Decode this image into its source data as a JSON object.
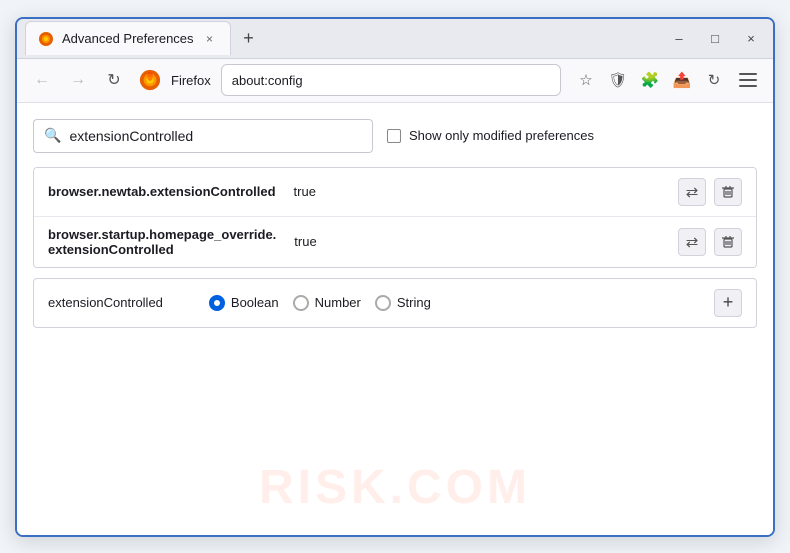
{
  "window": {
    "title": "Advanced Preferences",
    "tab_close": "×",
    "new_tab": "+",
    "minimize": "–",
    "maximize": "□",
    "close": "×"
  },
  "navbar": {
    "back": "←",
    "forward": "→",
    "refresh": "↻",
    "brand": "Firefox",
    "address": "about:config",
    "star_icon": "☆",
    "shield_icon": "🛡",
    "extension_icon": "🧩",
    "share_icon": "📤",
    "sync_icon": "↻"
  },
  "content": {
    "search_value": "extensionControlled",
    "search_placeholder": "extensionControlled",
    "checkbox_label": "Show only modified preferences",
    "watermark": "RISK.COM"
  },
  "results": [
    {
      "name": "browser.newtab.extensionControlled",
      "value": "true",
      "multiline": false
    },
    {
      "name_line1": "browser.startup.homepage_override.",
      "name_line2": "extensionControlled",
      "value": "true",
      "multiline": true
    }
  ],
  "add_row": {
    "pref_name": "extensionControlled",
    "type_boolean": "Boolean",
    "type_number": "Number",
    "type_string": "String",
    "add_label": "+"
  },
  "actions": {
    "swap": "⇄",
    "delete": "🗑"
  }
}
